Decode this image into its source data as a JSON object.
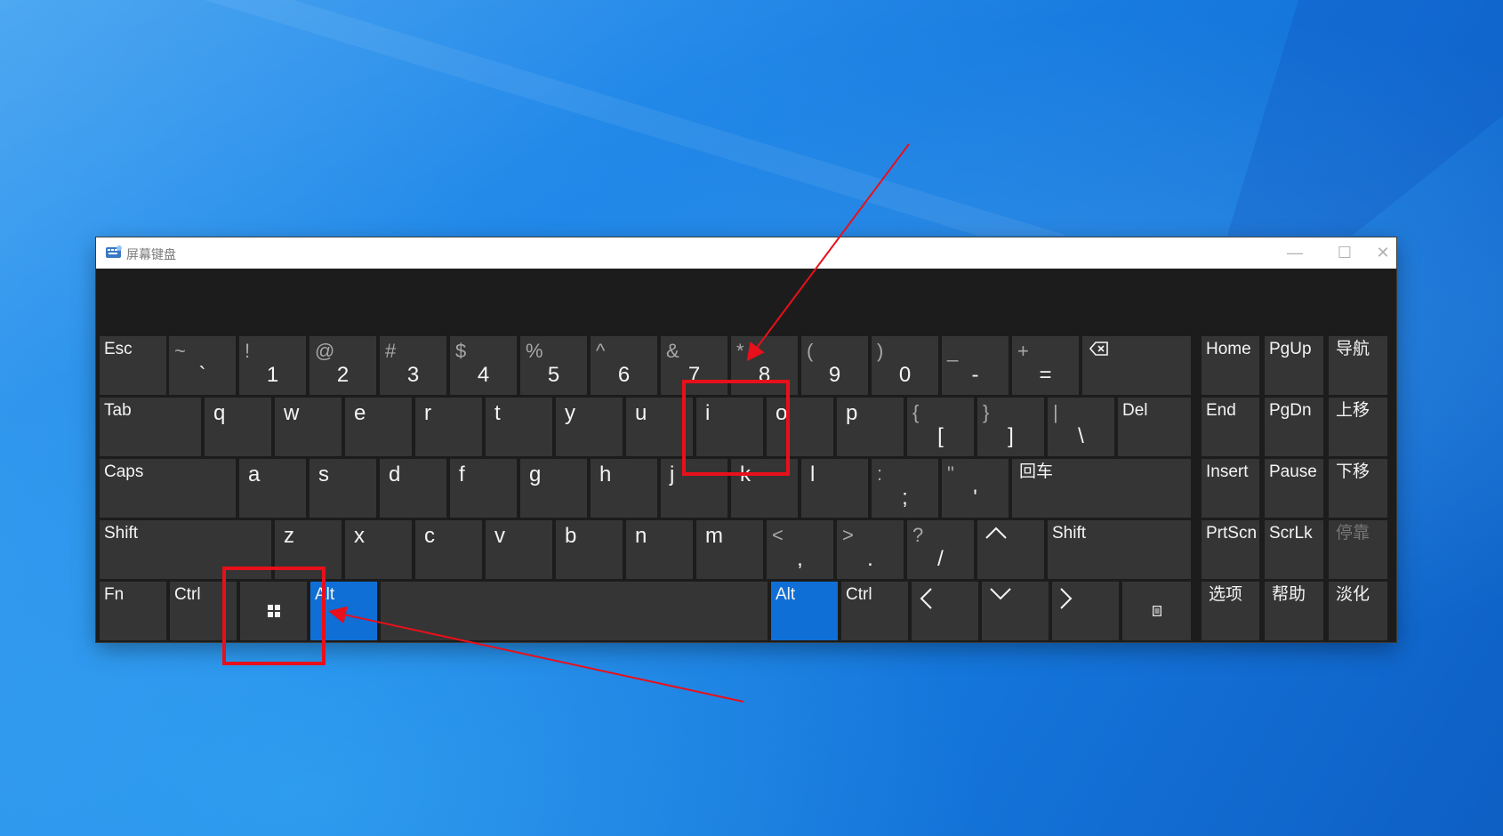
{
  "window": {
    "title": "屏幕键盘",
    "controls": {
      "minimize": "—",
      "maximize": "☐",
      "close": "✕"
    }
  },
  "keys": {
    "esc": "Esc",
    "tilde": {
      "top": "~",
      "main": "`"
    },
    "d1": {
      "top": "!",
      "main": "1"
    },
    "d2": {
      "top": "@",
      "main": "2"
    },
    "d3": {
      "top": "#",
      "main": "3"
    },
    "d4": {
      "top": "$",
      "main": "4"
    },
    "d5": {
      "top": "%",
      "main": "5"
    },
    "d6": {
      "top": "^",
      "main": "6"
    },
    "d7": {
      "top": "&",
      "main": "7"
    },
    "d8": {
      "top": "*",
      "main": "8"
    },
    "d9": {
      "top": "(",
      "main": "9"
    },
    "d0": {
      "top": ")",
      "main": "0"
    },
    "minus": {
      "top": "_",
      "main": "-"
    },
    "equal": {
      "top": "+",
      "main": "="
    },
    "tab": "Tab",
    "q": "q",
    "w": "w",
    "e": "e",
    "r": "r",
    "t": "t",
    "y": "y",
    "u": "u",
    "i": "i",
    "o": "o",
    "p": "p",
    "lbracket": {
      "top": "{",
      "main": "["
    },
    "rbracket": {
      "top": "}",
      "main": "]"
    },
    "backslash": {
      "top": "|",
      "main": "\\"
    },
    "del": "Del",
    "caps": "Caps",
    "a": "a",
    "s": "s",
    "d": "d",
    "f": "f",
    "g": "g",
    "h": "h",
    "j": "j",
    "k": "k",
    "l": "l",
    "semicolon": {
      "top": ":",
      "main": ";"
    },
    "quote": {
      "top": "\"",
      "main": "'"
    },
    "enter": "回车",
    "shift_left": "Shift",
    "z": "z",
    "x": "x",
    "c": "c",
    "v": "v",
    "b": "b",
    "n": "n",
    "m": "m",
    "comma": {
      "top": "<",
      "main": ","
    },
    "period": {
      "top": ">",
      "main": "."
    },
    "slash": {
      "top": "?",
      "main": "/"
    },
    "shift_right": "Shift",
    "fn": "Fn",
    "ctrl_left": "Ctrl",
    "alt_left": "Alt",
    "alt_right": "Alt",
    "ctrl_right": "Ctrl",
    "home": "Home",
    "pgup": "PgUp",
    "nav": "导航",
    "end": "End",
    "pgdn": "PgDn",
    "move_up": "上移",
    "insert": "Insert",
    "pause": "Pause",
    "move_down": "下移",
    "prtscn": "PrtScn",
    "scrlk": "ScrLk",
    "dock": "停靠",
    "options": "选项",
    "help": "帮助",
    "fade": "淡化"
  },
  "icons": {
    "backspace": "backspace-icon",
    "windows": "windows-logo-icon",
    "arrow_up": "arrow-up-icon",
    "arrow_left": "arrow-left-icon",
    "arrow_down": "arrow-down-icon",
    "arrow_right": "arrow-right-icon",
    "context_menu": "context-menu-icon",
    "app": "keyboard-app-icon"
  },
  "colors": {
    "accent": "#0f6fd6",
    "key": "#353535",
    "window_bg": "#1c1c1c",
    "annotation": "#e8101a"
  }
}
